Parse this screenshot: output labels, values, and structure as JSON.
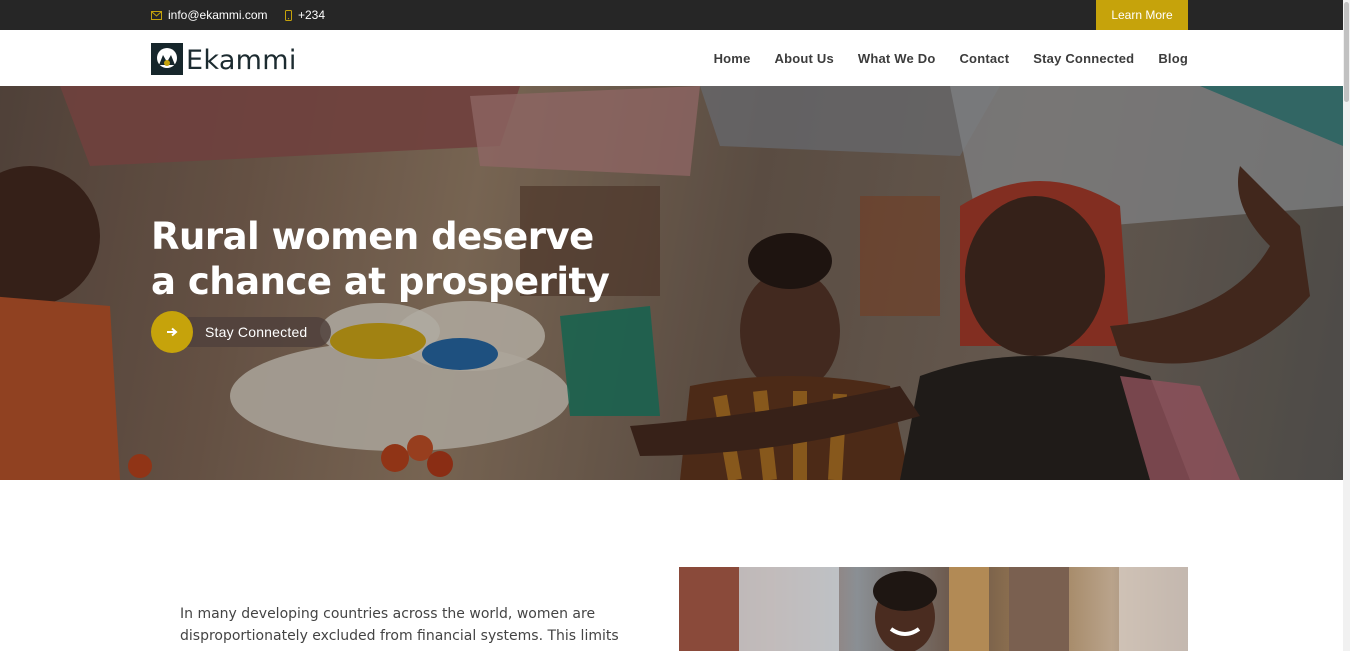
{
  "topbar": {
    "email": "info@ekammi.com",
    "email_icon": "envelope-icon",
    "phone": "+234",
    "phone_icon": "mobile-phone-icon",
    "learn_more": "Learn More"
  },
  "header": {
    "logo_text": "Ekammi",
    "logo_icon": "ekammi-logo-icon",
    "nav": [
      "Home",
      "About Us",
      "What We Do",
      "Contact",
      "Stay Connected",
      "Blog"
    ]
  },
  "hero": {
    "title_line1": "Rural women deserve",
    "title_line2": "a chance at prosperity",
    "cta_label": "Stay Connected",
    "cta_icon": "arrow-right-icon",
    "image": "market-women-photo"
  },
  "content": {
    "intro_line1": "In many developing countries across the world, women are",
    "intro_line2": "disproportionately excluded from financial systems. This limits",
    "image": "smiling-woman-photo"
  },
  "colors": {
    "accent": "#c6a30b",
    "topbar_bg": "#262626",
    "logo_dark": "#16262b"
  }
}
